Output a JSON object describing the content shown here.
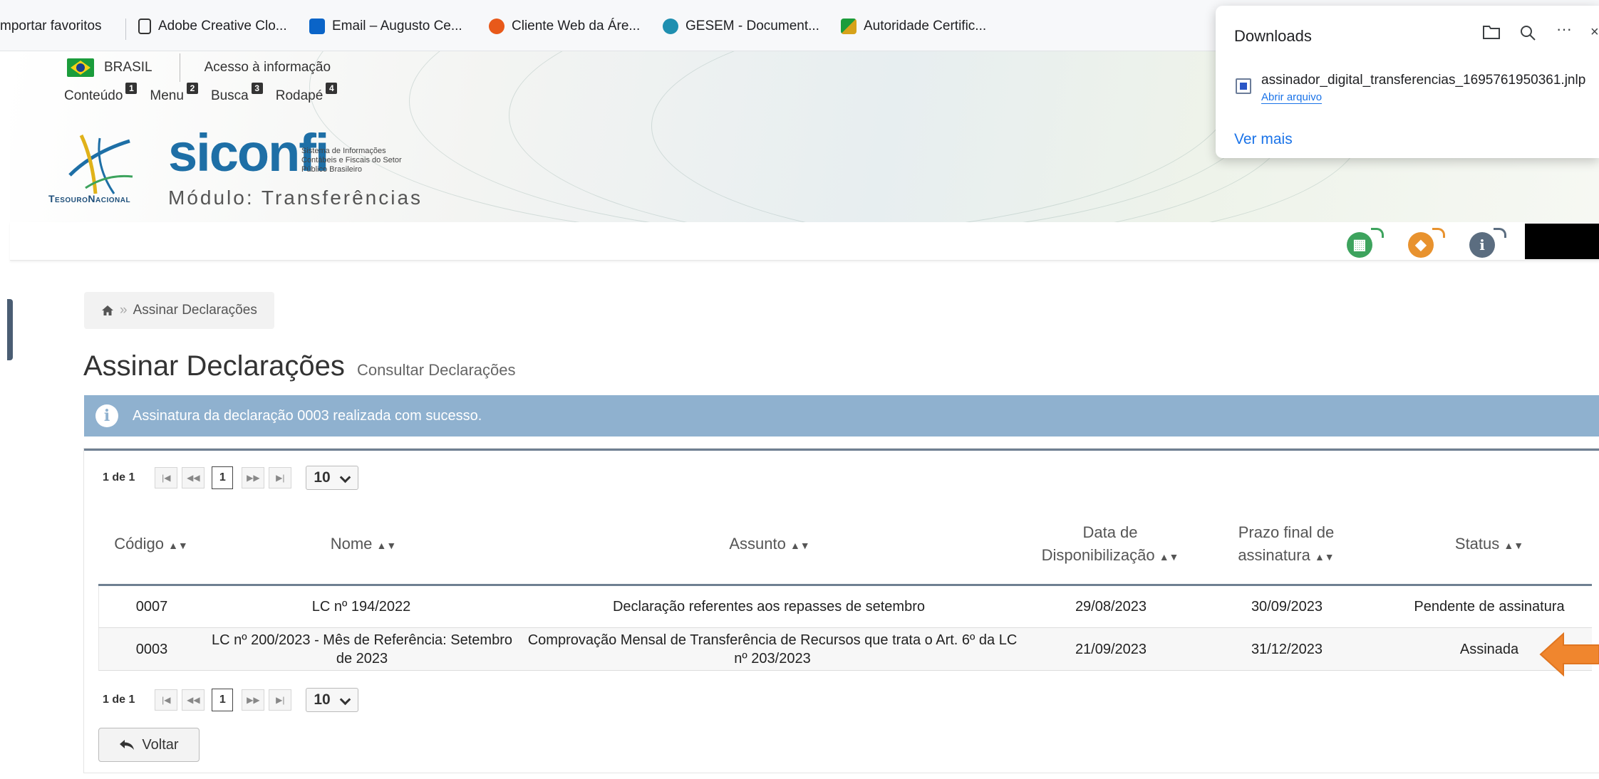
{
  "bookmarks": [
    {
      "label": "mportar favoritos"
    },
    {
      "label": "Adobe Creative Clo...",
      "color": "#ffffff"
    },
    {
      "label": "Email – Augusto Ce...",
      "color": "#0a64c8"
    },
    {
      "label": "Cliente Web da Áre...",
      "color": "#e8591a"
    },
    {
      "label": "GESEM - Document...",
      "color": "#1f8fb0"
    },
    {
      "label": "Autoridade Certific...",
      "color": "#d6a21a"
    }
  ],
  "gov": {
    "country": "BRASIL",
    "access": "Acesso à informação"
  },
  "skip_links": [
    {
      "label": "Conteúdo",
      "key": "1"
    },
    {
      "label": "Menu",
      "key": "2"
    },
    {
      "label": "Busca",
      "key": "3"
    },
    {
      "label": "Rodapé",
      "key": "4"
    }
  ],
  "brand": {
    "name": "siconfi",
    "subtitle": "Sistema de Informações Contábeis e Fiscais do Setor Público Brasileiro",
    "org": "TesouroNacional",
    "module": "Módulo: Transferências"
  },
  "app_icons": [
    {
      "icon": "calculator-icon",
      "color": "#3da35d",
      "glyph": "▦"
    },
    {
      "icon": "diamond-icon",
      "color": "#e8922e",
      "glyph": "◆"
    },
    {
      "icon": "info-icon",
      "color": "#5b6d80",
      "glyph": "i"
    }
  ],
  "breadcrumb": {
    "current": "Assinar Declarações"
  },
  "page": {
    "title": "Assinar Declarações",
    "subtitle": "Consultar Declarações"
  },
  "alert": {
    "text": "Assinatura da declaração 0003 realizada com sucesso.",
    "close": "×"
  },
  "pager": {
    "count": "1 de 1",
    "page": "1",
    "page_size": "10"
  },
  "table": {
    "headers": [
      "Código",
      "Nome",
      "Assunto",
      "Data de Disponibilização",
      "Prazo final de assinatura",
      "Status"
    ],
    "rows": [
      {
        "codigo": "0007",
        "nome": "LC nº 194/2022",
        "assunto": "Declaração referentes aos repasses de setembro",
        "data": "29/08/2023",
        "prazo": "30/09/2023",
        "status": "Pendente de assinatura"
      },
      {
        "codigo": "0003",
        "nome": "LC nº 200/2023 - Mês de Referência: Setembro de 2023",
        "assunto": "Comprovação Mensal de Transferência de Recursos que trata o Art. 6º da LC nº 203/2023",
        "data": "21/09/2023",
        "prazo": "31/12/2023",
        "status": "Assinada"
      }
    ]
  },
  "back_button": "Voltar",
  "downloads": {
    "title": "Downloads",
    "file": "assinador_digital_transferencias_1695761950361.jnlp",
    "open": "Abrir arquivo",
    "more": "Ver mais"
  },
  "colors": {
    "accent": "#1e6fa6",
    "alert": "#8fb1cf",
    "arrow": "#f0862e"
  }
}
